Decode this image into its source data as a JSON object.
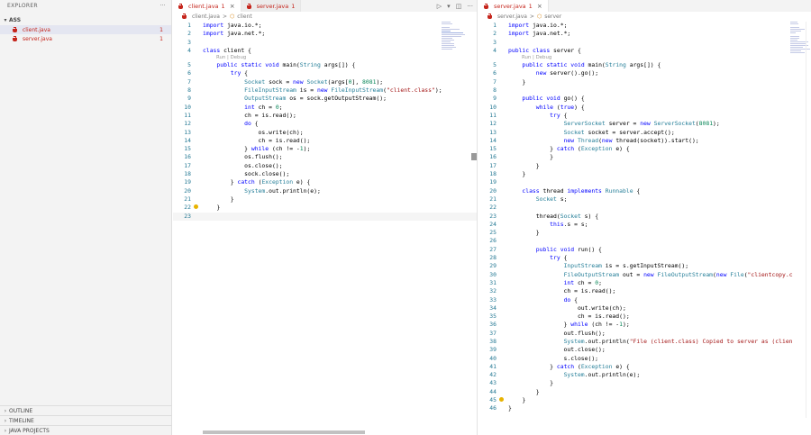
{
  "sidebar": {
    "title": "EXPLORER",
    "more": "···",
    "section": "ASS",
    "files": [
      {
        "name": "client.java",
        "count": "1"
      },
      {
        "name": "server.java",
        "count": "1"
      }
    ],
    "bottom": [
      "OUTLINE",
      "TIMELINE",
      "JAVA PROJECTS"
    ]
  },
  "left": {
    "tabs": [
      {
        "label": "client.java",
        "count": "1"
      },
      {
        "label": "server.java",
        "count": "1"
      }
    ],
    "breadcrumb": {
      "file": "client.java",
      "sep": ">",
      "symbol": "client"
    },
    "codelens": "Run | Debug"
  },
  "right": {
    "tab": {
      "label": "server.java",
      "count": "1"
    },
    "breadcrumb": {
      "file": "server.java",
      "sep": ">",
      "symbol": "server"
    },
    "codelens": "Run | Debug"
  },
  "colors": {
    "error": "#c5251c",
    "keyword": "#0000ff",
    "type": "#267f99",
    "string": "#a31515",
    "linenum": "#237893"
  },
  "icons": [
    "java-file-icon",
    "close-icon",
    "run-icon",
    "split-editor-icon",
    "more-icon",
    "lightbulb-icon",
    "class-symbol-icon"
  ],
  "clientCode": [
    "import java.io.*;",
    "import java.net.*;",
    "",
    "class client {",
    "    public static void main(String args[]) {",
    "        try {",
    "            Socket sock = new Socket(args[0], 8081);",
    "            FileInputStream is = new FileInputStream(\"client.class\");",
    "            OutputStream os = sock.getOutputStream();",
    "            int ch = 0;",
    "            ch = is.read();",
    "            do {",
    "                os.write(ch);",
    "                ch = is.read();",
    "            } while (ch != -1);",
    "            os.flush();",
    "            os.close();",
    "            sock.close();",
    "        } catch (Exception e) {",
    "            System.out.println(e);",
    "        }",
    "    }",
    ""
  ],
  "serverCode": [
    "import java.io.*;",
    "import java.net.*;",
    "",
    "public class server {",
    "    public static void main(String args[]) {",
    "        new server().go();",
    "    }",
    "",
    "    public void go() {",
    "        while (true) {",
    "            try {",
    "                ServerSocket server = new ServerSocket(8081);",
    "                Socket socket = server.accept();",
    "                new Thread(new thread(socket)).start();",
    "            } catch (Exception e) {",
    "            }",
    "        }",
    "    }",
    "",
    "    class thread implements Runnable {",
    "        Socket s;",
    "",
    "        thread(Socket s) {",
    "            this.s = s;",
    "        }",
    "",
    "        public void run() {",
    "            try {",
    "                InputStream is = s.getInputStream();",
    "                FileOutputStream out = new FileOutputStream(new File(\"clientcopy.c",
    "                int ch = 0;",
    "                ch = is.read();",
    "                do {",
    "                    out.write(ch);",
    "                    ch = is.read();",
    "                } while (ch != -1);",
    "                out.flush();",
    "                System.out.println(\"File (client.class) Copied to server as (clien",
    "                out.close();",
    "                s.close();",
    "            } catch (Exception e) {",
    "                System.out.println(e);",
    "            }",
    "        }",
    "    }",
    "}"
  ]
}
